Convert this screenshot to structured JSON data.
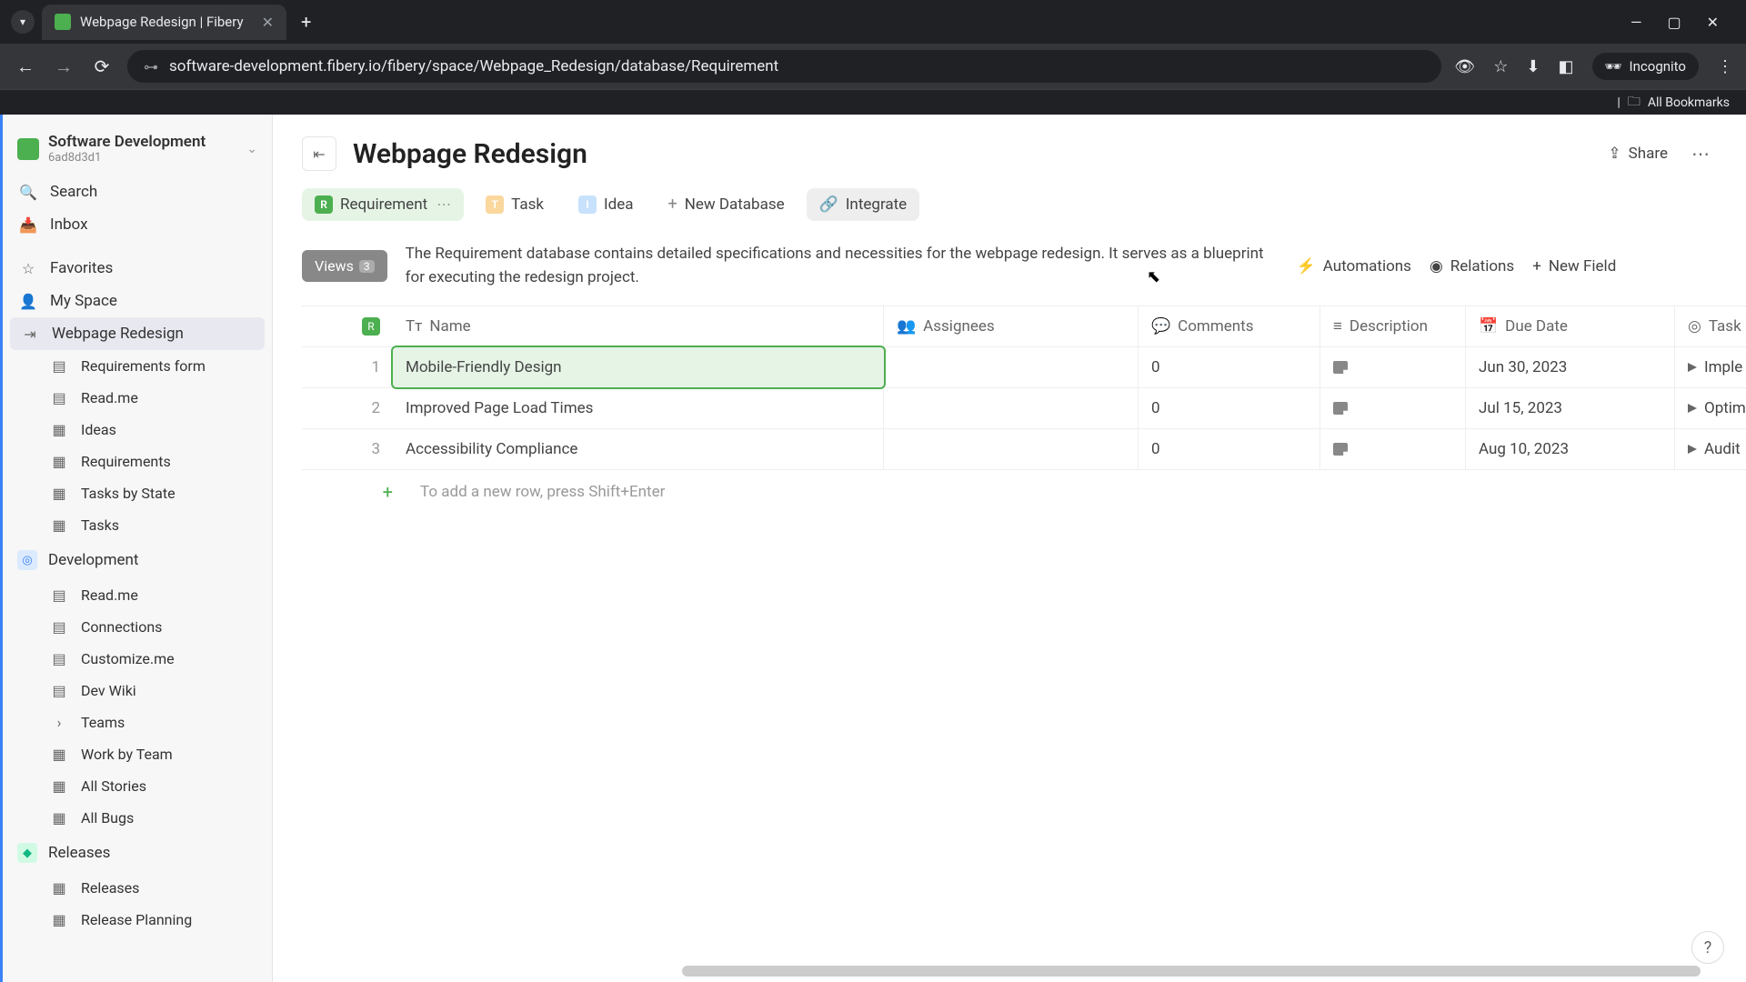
{
  "browser": {
    "tab_title": "Webpage Redesign | Fibery",
    "url": "software-development.fibery.io/fibery/space/Webpage_Redesign/database/Requirement",
    "incognito": "Incognito",
    "bookmarks": "All Bookmarks"
  },
  "workspace": {
    "name": "Software Development",
    "id": "6ad8d3d1"
  },
  "sidebar": {
    "search": "Search",
    "inbox": "Inbox",
    "favorites": "Favorites",
    "myspace": "My Space",
    "spaces": [
      {
        "name": "Webpage Redesign",
        "items": [
          "Requirements form",
          "Read.me",
          "Ideas",
          "Requirements",
          "Tasks by State",
          "Tasks"
        ]
      },
      {
        "name": "Development",
        "items": [
          "Read.me",
          "Connections",
          "Customize.me",
          "Dev Wiki",
          "Teams",
          "Work by Team",
          "All Stories",
          "All Bugs"
        ]
      },
      {
        "name": "Releases",
        "items": [
          "Releases",
          "Release Planning"
        ]
      }
    ]
  },
  "page": {
    "title": "Webpage Redesign",
    "share": "Share"
  },
  "db_tabs": {
    "requirement": "Requirement",
    "task": "Task",
    "idea": "Idea",
    "new_db": "New Database",
    "integrate": "Integrate"
  },
  "views": {
    "label": "Views",
    "count": "3",
    "description": "The Requirement database contains detailed specifications and necessities for the webpage redesign. It serves as a blueprint for executing the redesign project.",
    "automations": "Automations",
    "relations": "Relations",
    "new_field": "New Field"
  },
  "columns": {
    "name": "Name",
    "assignees": "Assignees",
    "comments": "Comments",
    "description": "Description",
    "due": "Due Date",
    "task": "Task"
  },
  "rows": [
    {
      "idx": "1",
      "name": "Mobile-Friendly Design",
      "comments": "0",
      "due": "Jun 30, 2023",
      "task": "Imple"
    },
    {
      "idx": "2",
      "name": "Improved Page Load Times",
      "comments": "0",
      "due": "Jul 15, 2023",
      "task": "Optim"
    },
    {
      "idx": "3",
      "name": "Accessibility Compliance",
      "comments": "0",
      "due": "Aug 10, 2023",
      "task": "Audit"
    }
  ],
  "new_row": "To add a new row, press Shift+Enter"
}
